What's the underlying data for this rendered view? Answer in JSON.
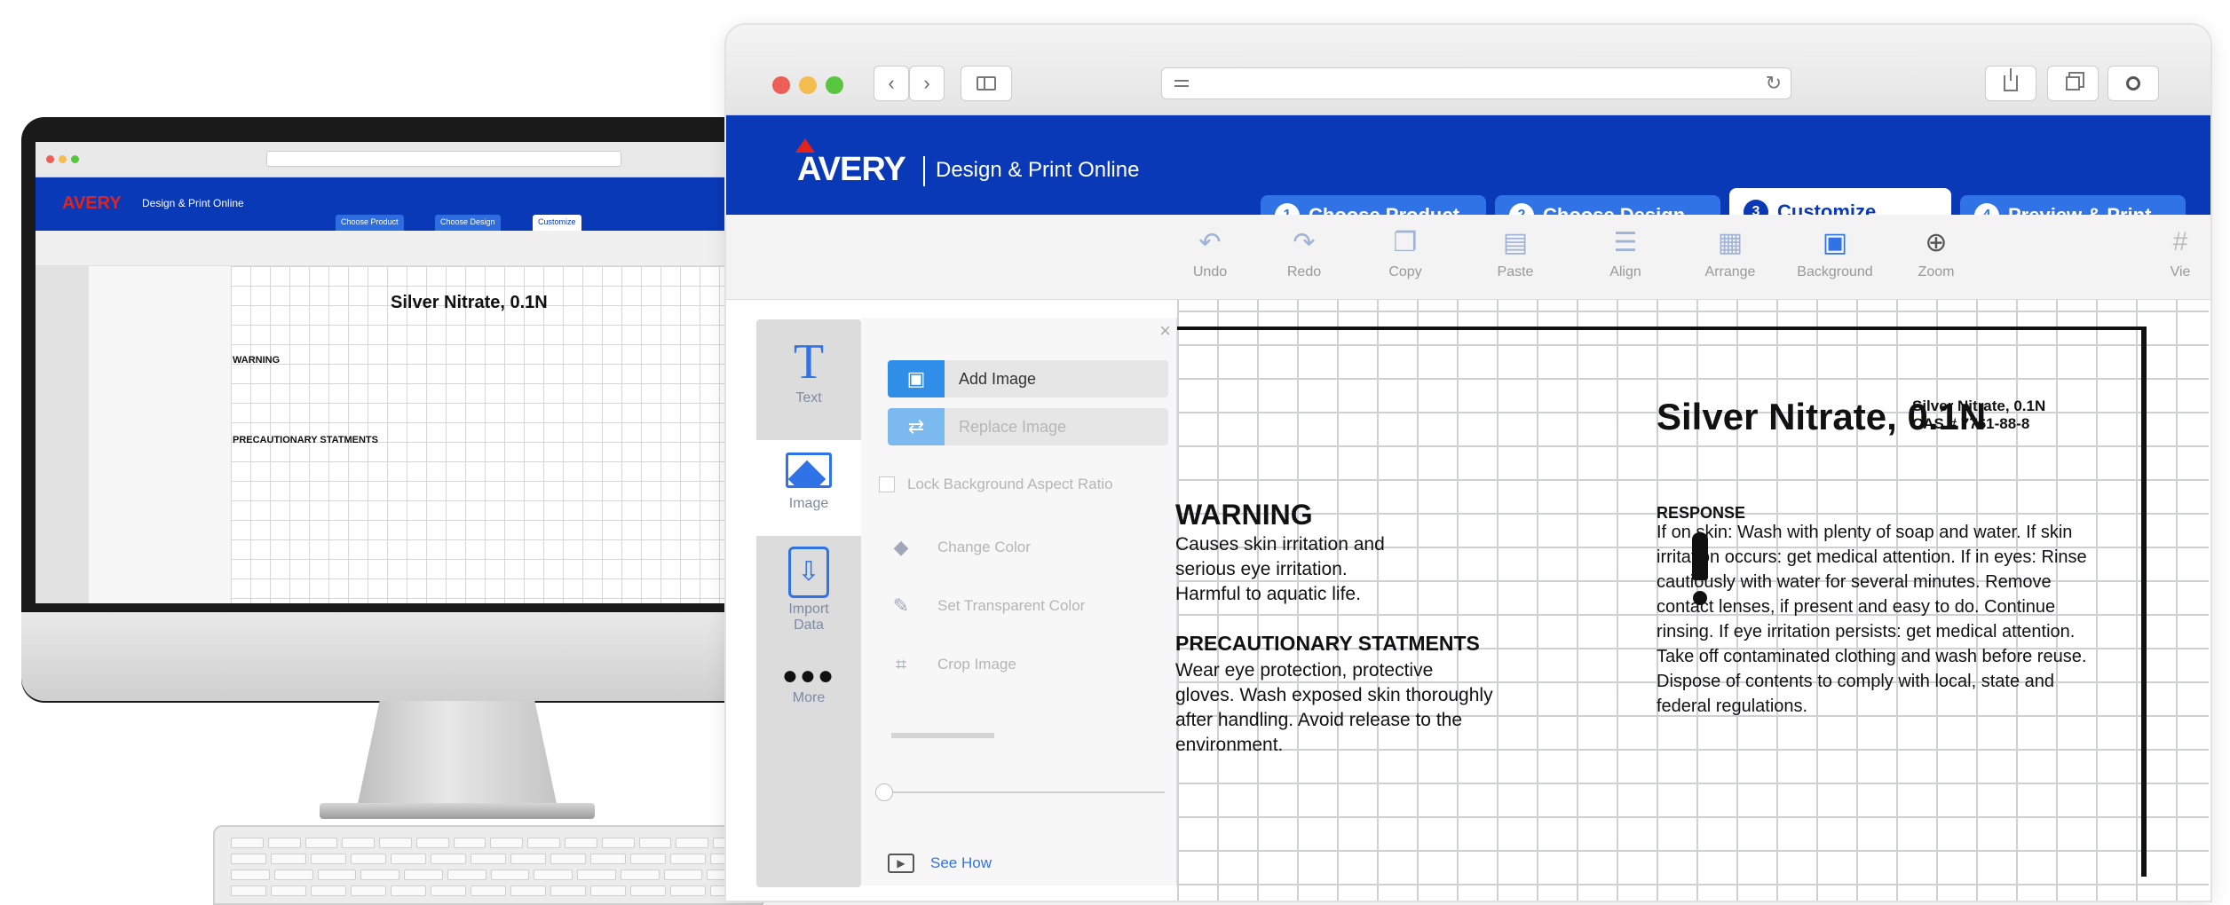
{
  "browser": {
    "nav_back": "‹",
    "nav_forward": "›",
    "reload": "↻"
  },
  "app": {
    "brand_logo": "AVERY",
    "brand_subtitle": "Design & Print Online"
  },
  "steps": [
    {
      "num": "1",
      "label": "Choose Product"
    },
    {
      "num": "2",
      "label": "Choose Design"
    },
    {
      "num": "3",
      "label": "Customize"
    },
    {
      "num": "4",
      "label": "Preview & Print"
    }
  ],
  "toolbar": {
    "undo": "Undo",
    "redo": "Redo",
    "copy": "Copy",
    "paste": "Paste",
    "align": "Align",
    "arrange": "Arrange",
    "background": "Background",
    "zoom": "Zoom",
    "view": "Vie"
  },
  "rail": {
    "text": "Text",
    "image": "Image",
    "import_data": "Import Data",
    "more": "More"
  },
  "panel": {
    "close": "×",
    "add_image": "Add Image",
    "replace_image": "Replace Image",
    "lock_aspect": "Lock Background Aspect Ratio",
    "change_color": "Change Color",
    "set_transparent": "Set Transparent Color",
    "crop_image": "Crop Image",
    "see_how": "See How"
  },
  "label": {
    "title": "Silver Nitrate, 0.1N",
    "small_line1": "Silver Nitrate, 0.1N",
    "small_line2": "CAS # 7761-88-8",
    "warning": "WARNING",
    "warning_body": [
      "Causes skin irritation and",
      "serious eye irritation.",
      "Harmful to aquatic life."
    ],
    "precautionary_title": "PRECAUTIONARY STATMENTS",
    "precautionary_body": [
      "Wear eye protection, protective",
      "gloves. Wash exposed skin thoroughly",
      "after handling. Avoid release to the",
      "environment."
    ],
    "response_title": "RESPONSE",
    "response_body": "If on skin: Wash with plenty of soap and water. If skin irritation occurs: get medical attention. If in eyes: Rinse cautiously with water for several minutes. Remove contact lenses, if present and easy to do. Continue rinsing. If eye irritation persists: get medical attention. Take off contaminated clothing and wash before reuse. Dispose of contents to comply with local, state and federal regulations."
  },
  "colors": {
    "brand_blue": "#0a39b8",
    "tab_blue": "#2f73e6",
    "accent_red": "#e1231c",
    "button_blue": "#2f8fe8"
  }
}
